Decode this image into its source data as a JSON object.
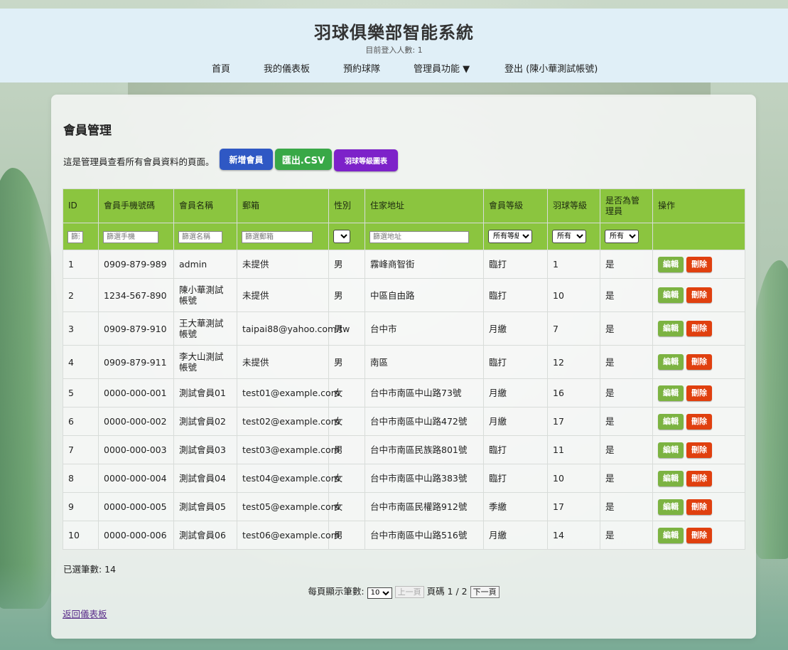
{
  "header": {
    "title": "羽球俱樂部智能系統",
    "online": "目前登入人數: 1"
  },
  "nav": {
    "home": "首頁",
    "dashboard": "我的儀表板",
    "reserve": "預約球隊",
    "admin": "管理員功能 ▼",
    "logout": "登出 (陳小華測試帳號)"
  },
  "page": {
    "title": "會員管理",
    "intro": "這是管理員查看所有會員資料的頁面。",
    "btn_add": "新增會員",
    "btn_csv": "匯出.CSV",
    "btn_chart": "羽球等級圖表"
  },
  "table": {
    "headers": [
      "ID",
      "會員手機號碼",
      "會員名稱",
      "郵箱",
      "性別",
      "住家地址",
      "會員等級",
      "羽球等級",
      "是否為管理員",
      "操作"
    ],
    "filters": {
      "id": "篩選",
      "phone": "篩選手機",
      "name": "篩選名稱",
      "email": "篩選郵箱",
      "address": "篩選地址",
      "level": "所有等級",
      "badminton": "所有",
      "admin": "所有"
    },
    "edit_label": "編輯",
    "delete_label": "刪除",
    "rows": [
      {
        "id": "1",
        "phone": "0909-879-989",
        "name": "admin",
        "email": "未提供",
        "gender": "男",
        "address": "霧峰商智街",
        "level": "臨打",
        "badminton": "1",
        "admin": "是"
      },
      {
        "id": "2",
        "phone": "1234-567-890",
        "name": "陳小華測試帳號",
        "email": "未提供",
        "gender": "男",
        "address": "中區自由路",
        "level": "臨打",
        "badminton": "10",
        "admin": "是"
      },
      {
        "id": "3",
        "phone": "0909-879-910",
        "name": "王大華測試帳號",
        "email": "taipai88@yahoo.com.tw",
        "gender": "男",
        "address": "台中市",
        "level": "月繳",
        "badminton": "7",
        "admin": "是"
      },
      {
        "id": "4",
        "phone": "0909-879-911",
        "name": "李大山測試帳號",
        "email": "未提供",
        "gender": "男",
        "address": "南區",
        "level": "臨打",
        "badminton": "12",
        "admin": "是"
      },
      {
        "id": "5",
        "phone": "0000-000-001",
        "name": "測試會員01",
        "email": "test01@example.com",
        "gender": "女",
        "address": "台中市南區中山路73號",
        "level": "月繳",
        "badminton": "16",
        "admin": "是"
      },
      {
        "id": "6",
        "phone": "0000-000-002",
        "name": "測試會員02",
        "email": "test02@example.com",
        "gender": "女",
        "address": "台中市南區中山路472號",
        "level": "月繳",
        "badminton": "17",
        "admin": "是"
      },
      {
        "id": "7",
        "phone": "0000-000-003",
        "name": "測試會員03",
        "email": "test03@example.com",
        "gender": "男",
        "address": "台中市南區民族路801號",
        "level": "臨打",
        "badminton": "11",
        "admin": "是"
      },
      {
        "id": "8",
        "phone": "0000-000-004",
        "name": "測試會員04",
        "email": "test04@example.com",
        "gender": "女",
        "address": "台中市南區中山路383號",
        "level": "臨打",
        "badminton": "10",
        "admin": "是"
      },
      {
        "id": "9",
        "phone": "0000-000-005",
        "name": "測試會員05",
        "email": "test05@example.com",
        "gender": "女",
        "address": "台中市南區民權路912號",
        "level": "季繳",
        "badminton": "17",
        "admin": "是"
      },
      {
        "id": "10",
        "phone": "0000-000-006",
        "name": "測試會員06",
        "email": "test06@example.com",
        "gender": "男",
        "address": "台中市南區中山路516號",
        "level": "月繳",
        "badminton": "14",
        "admin": "是"
      }
    ]
  },
  "footer": {
    "selected": "已選筆數: 14",
    "per_page_label": "每頁顯示筆數:",
    "per_page_value": "10",
    "prev": "上一頁",
    "page_info": "頁碼 1 / 2",
    "next": "下一頁",
    "back": "返回儀表板"
  },
  "colors": {
    "header_bg": "#e0eff7",
    "table_head": "#8bc53f",
    "btn_add": "#2f58c4",
    "btn_csv": "#39a847",
    "btn_chart": "#7d22c9",
    "btn_edit": "#7cb342",
    "btn_delete": "#e0400f"
  }
}
